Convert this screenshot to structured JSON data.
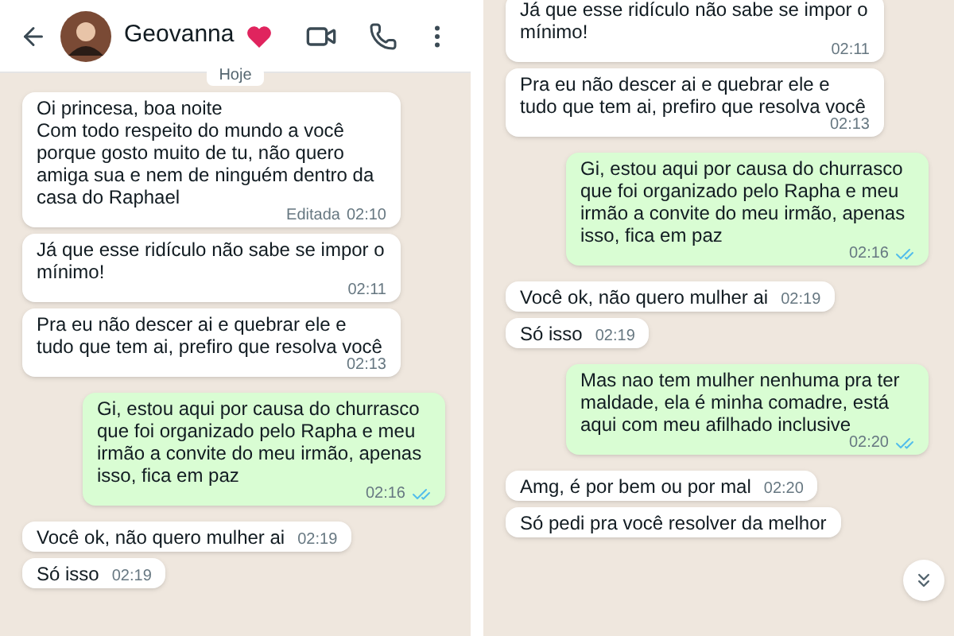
{
  "panels": [
    {
      "header": {
        "contact_name": "Geovanna"
      },
      "date_chip": "Hoje",
      "messages": [
        {
          "kind": "incoming",
          "text": "Oi princesa, boa noite\nCom todo respeito do mundo a você porque gosto muito de tu, não quero amiga sua e nem de ninguém dentro da casa do Raphael",
          "edited_label": "Editada",
          "time": "02:10"
        },
        {
          "kind": "incoming",
          "text": "Já que esse ridículo não sabe se impor o mínimo!",
          "time": "02:11"
        },
        {
          "kind": "incoming",
          "text": "Pra eu não descer ai e quebrar ele e tudo que tem ai, prefiro que resolva você",
          "time": "02:13"
        },
        {
          "kind": "outgoing",
          "text": "Gi, estou aqui por causa do churrasco que foi organizado pelo Rapha e meu irmão a convite do meu irmão, apenas isso, fica em paz",
          "time": "02:16",
          "read": true
        },
        {
          "kind": "incoming",
          "text": "Você ok, não quero mulher ai",
          "time": "02:19"
        },
        {
          "kind": "incoming",
          "text": "Só isso",
          "time": "02:19"
        }
      ]
    },
    {
      "messages": [
        {
          "kind": "incoming",
          "text": "Já que esse ridículo não sabe se impor o mínimo!",
          "time": "02:11"
        },
        {
          "kind": "incoming",
          "text": "Pra eu não descer ai e quebrar ele e tudo que tem ai, prefiro que resolva você",
          "time": "02:13"
        },
        {
          "kind": "outgoing",
          "text": "Gi, estou aqui por causa do churrasco que foi organizado pelo Rapha e meu irmão a convite do meu irmão, apenas isso, fica em paz",
          "time": "02:16",
          "read": true
        },
        {
          "kind": "incoming",
          "text": "Você ok, não quero mulher ai",
          "time": "02:19"
        },
        {
          "kind": "incoming",
          "text": "Só isso",
          "time": "02:19"
        },
        {
          "kind": "outgoing",
          "text": "Mas nao tem mulher nenhuma pra ter maldade, ela é minha comadre, está aqui com meu afilhado inclusive",
          "time": "02:20",
          "read": true
        },
        {
          "kind": "incoming",
          "text": "Amg, é por bem ou por mal",
          "time": "02:20"
        },
        {
          "kind": "incoming",
          "text": "Só pedi pra você resolver da melhor"
        }
      ],
      "controls": [
        {
          "kind": "scroll_down"
        }
      ]
    }
  ]
}
